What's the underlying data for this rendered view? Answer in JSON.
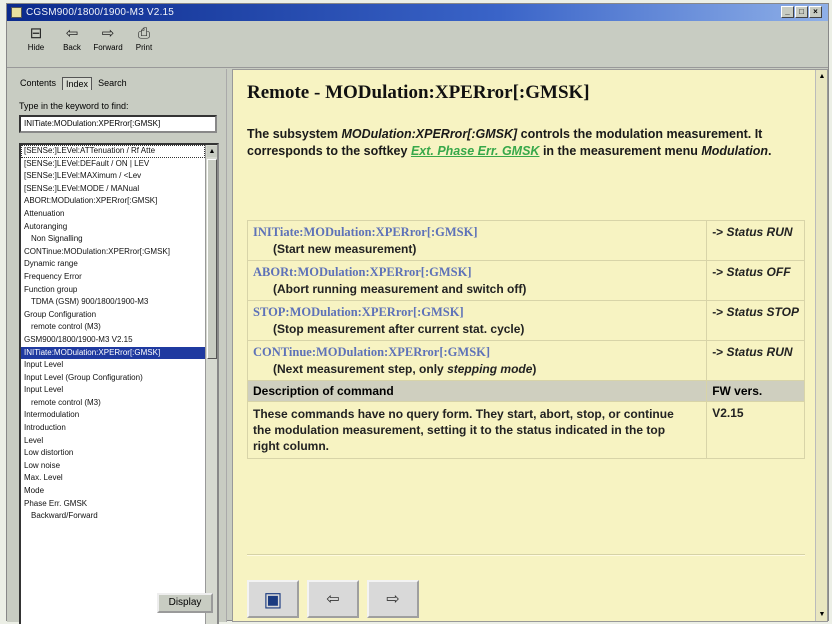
{
  "window": {
    "title": "CGSM900/1800/1900-M3 V2.15"
  },
  "toolbar": {
    "buttons": [
      {
        "label": "Hide",
        "icon": "hide-icon",
        "glyph": "⊟"
      },
      {
        "label": "Back",
        "icon": "back-arrow-icon",
        "glyph": "⇦"
      },
      {
        "label": "Forward",
        "icon": "forward-arrow-icon",
        "glyph": "⇨"
      },
      {
        "label": "Print",
        "icon": "printer-icon",
        "glyph": "⎙"
      }
    ]
  },
  "navigator": {
    "tabs": [
      "Contents",
      "Index",
      "Search"
    ],
    "active_tab": "Index",
    "find_label": "Type in the keyword to find:",
    "keyword_value": "INITiate:MODulation:XPERror[:GMSK]",
    "index_items": [
      {
        "text": "[SENSe:]LEVel:ATTenuation / Rf Atte",
        "type": "top",
        "dotted": true
      },
      {
        "text": "[SENSe:]LEVel:DEFault / ON | LEV",
        "type": "top"
      },
      {
        "text": "[SENSe:]LEVel:MAXimum / <Lev",
        "type": "top"
      },
      {
        "text": "[SENSe:]LEVel:MODE / MANual",
        "type": "top"
      },
      {
        "text": "ABORt:MODulation:XPERror[:GMSK]",
        "type": "top"
      },
      {
        "text": "Attenuation",
        "type": "top"
      },
      {
        "text": "Autoranging",
        "type": "top"
      },
      {
        "text": "Non Signalling",
        "type": "sub"
      },
      {
        "text": "CONTinue:MODulation:XPERror[:GMSK]",
        "type": "top"
      },
      {
        "text": "Dynamic range",
        "type": "top"
      },
      {
        "text": "Frequency Error",
        "type": "top"
      },
      {
        "text": "Function group",
        "type": "top"
      },
      {
        "text": "TDMA (GSM) 900/1800/1900-M3",
        "type": "sub"
      },
      {
        "text": "Group Configuration",
        "type": "top"
      },
      {
        "text": "remote control (M3)",
        "type": "sub"
      },
      {
        "text": "GSM900/1800/1900-M3 V2.15",
        "type": "top"
      },
      {
        "text": "INITiate:MODulation:XPERror[:GMSK]",
        "type": "top",
        "selected": true
      },
      {
        "text": "Input Level",
        "type": "top"
      },
      {
        "text": "Input Level (Group Configuration)",
        "type": "top"
      },
      {
        "text": "Input Level",
        "type": "top"
      },
      {
        "text": "remote control (M3)",
        "type": "sub"
      },
      {
        "text": "Intermodulation",
        "type": "top"
      },
      {
        "text": "Introduction",
        "type": "top"
      },
      {
        "text": "Level",
        "type": "top"
      },
      {
        "text": "Low distortion",
        "type": "top"
      },
      {
        "text": "Low noise",
        "type": "top"
      },
      {
        "text": "Max. Level",
        "type": "top"
      },
      {
        "text": "Mode",
        "type": "top"
      },
      {
        "text": "Phase Err. GMSK",
        "type": "top"
      },
      {
        "text": "Backward/Forward",
        "type": "sub"
      }
    ],
    "display_button": "Display"
  },
  "topic": {
    "title": "Remote - MODulation:XPERror[:GMSK]",
    "intro_prefix": "The subsystem ",
    "intro_subsystem": "MODulation:XPERror[:GMSK]",
    "intro_middle": " controls the modulation measurement. It corresponds to the softkey ",
    "intro_softkey_link": "Ext. Phase Err. GMSK",
    "intro_suffix_1": " in the measurement menu ",
    "intro_menu": "Modulation",
    "intro_suffix_2": ".",
    "commands": [
      {
        "command": "INITiate:MODulation:XPERror[:GMSK]",
        "description": "(Start new measurement)",
        "description_italic": "",
        "description_end": "",
        "status_prefix": "-> ",
        "status": "Status RUN"
      },
      {
        "command": "ABORt:MODulation:XPERror[:GMSK]",
        "description": "(Abort running measurement and switch off)",
        "description_italic": "",
        "description_end": "",
        "status_prefix": "-> ",
        "status": "Status OFF"
      },
      {
        "command": "STOP:MODulation:XPERror[:GMSK]",
        "description": "(Stop measurement after current stat. cycle)",
        "description_italic": "",
        "description_end": "",
        "status_prefix": "-> ",
        "status": "Status STOP"
      },
      {
        "command": "CONTinue:MODulation:XPERror[:GMSK]",
        "description": "(Next measurement step, only ",
        "description_italic": "stepping mode",
        "description_end": ")",
        "status_prefix": "-> ",
        "status": "Status RUN"
      }
    ],
    "table_header": {
      "left": "Description of command",
      "right": "FW vers."
    },
    "description_text": "These commands have no query form. They start, abort, stop, or continue the modulation measurement, setting it to the status indicated in the top right column.",
    "fw_version": "V2.15",
    "nav_buttons": [
      {
        "name": "home-button",
        "icon": "help-home-icon",
        "glyph": "▣"
      },
      {
        "name": "previous-topic-button",
        "icon": "previous-arrow-icon",
        "glyph": "⇦"
      },
      {
        "name": "next-topic-button",
        "icon": "next-arrow-icon",
        "glyph": "⇨"
      }
    ]
  }
}
